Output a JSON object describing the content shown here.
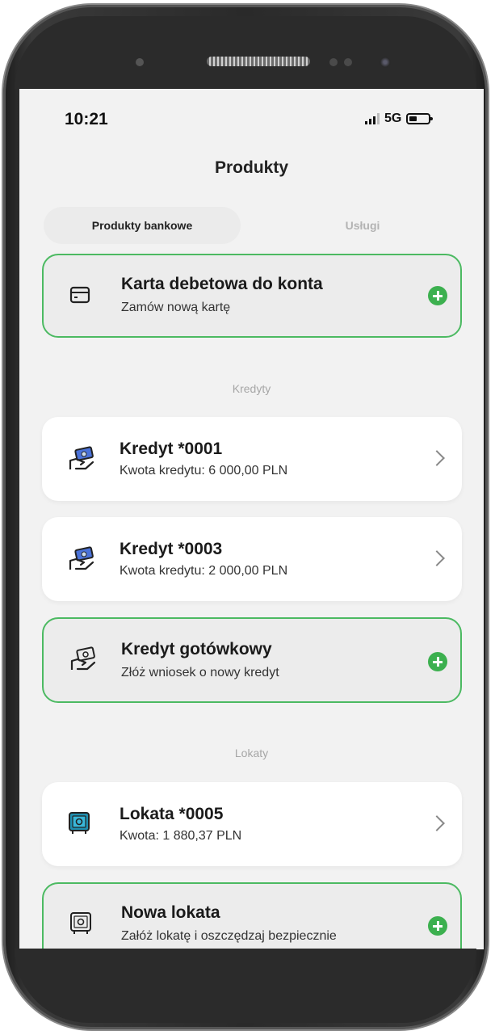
{
  "status_bar": {
    "time": "10:21",
    "network": "5G"
  },
  "header": {
    "title": "Produkty"
  },
  "tabs": [
    {
      "label": "Produkty bankowe",
      "active": true
    },
    {
      "label": "Usługi",
      "active": false
    }
  ],
  "sections": {
    "kredyty_label": "Kredyty",
    "lokaty_label": "Lokaty"
  },
  "cards": {
    "debit_card": {
      "title": "Karta debetowa do konta",
      "subtitle": "Zamów nową kartę",
      "icon": "card-icon"
    },
    "credit_0001": {
      "title": "Kredyt *0001",
      "subtitle": "Kwota kredytu: 6 000,00 PLN",
      "icon": "cash-hand-icon"
    },
    "credit_0003": {
      "title": "Kredyt *0003",
      "subtitle": "Kwota kredytu: 2 000,00 PLN",
      "icon": "cash-hand-icon"
    },
    "cash_loan": {
      "title": "Kredyt gotówkowy",
      "subtitle": "Złóż wniosek o nowy kredyt",
      "icon": "cash-hand-outline-icon"
    },
    "deposit_0005": {
      "title": "Lokata *0005",
      "subtitle": "Kwota: 1 880,37 PLN",
      "icon": "safe-icon"
    },
    "new_deposit": {
      "title": "Nowa lokata",
      "subtitle": "Załóż lokatę i oszczędzaj bezpiecznie",
      "icon": "safe-outline-icon"
    }
  },
  "colors": {
    "accent_green": "#3cb04f",
    "outline_green": "#4cba62",
    "icon_blue": "#3a6fd8",
    "safe_teal": "#1f8fb0"
  }
}
